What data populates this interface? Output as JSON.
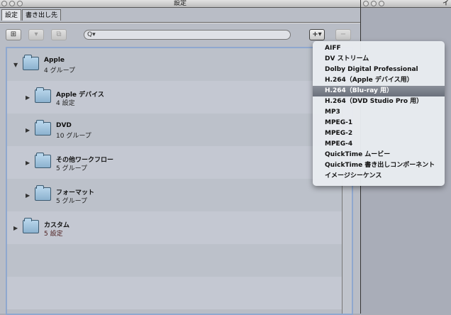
{
  "window": {
    "title": "設定",
    "right_title": "イ"
  },
  "tabs": [
    {
      "label": "設定",
      "active": true
    },
    {
      "label": "書き出し先",
      "active": false
    }
  ],
  "toolbar": {
    "add_group": "⊞",
    "add_menu": "+▾",
    "remove": "−",
    "search_placeholder": "",
    "search_icon": "Q▾"
  },
  "tree": [
    {
      "name": "Apple",
      "sub": "4 グループ",
      "expanded": true,
      "level": 0
    },
    {
      "name": "Apple デバイス",
      "sub": "4 設定",
      "expanded": false,
      "level": 1
    },
    {
      "name": "DVD",
      "sub": "10 グループ",
      "expanded": false,
      "level": 1
    },
    {
      "name": "その他ワークフロー",
      "sub": "5 グループ",
      "expanded": false,
      "level": 1
    },
    {
      "name": "フォーマット",
      "sub": "5 グループ",
      "expanded": false,
      "level": 1
    },
    {
      "name": "カスタム",
      "sub": "5 設定",
      "expanded": false,
      "level": 0
    }
  ],
  "menu": {
    "selected_index": 4,
    "items": [
      "AIFF",
      "DV ストリーム",
      "Dolby Digital Professional",
      "H.264（Apple デバイス用）",
      "H.264（Blu-ray 用）",
      "H.264（DVD Studio Pro 用）",
      "MP3",
      "MPEG-1",
      "MPEG-2",
      "MPEG-4",
      "QuickTime ムービー",
      "QuickTime 書き出しコンポーネント",
      "イメージシーケンス"
    ]
  }
}
